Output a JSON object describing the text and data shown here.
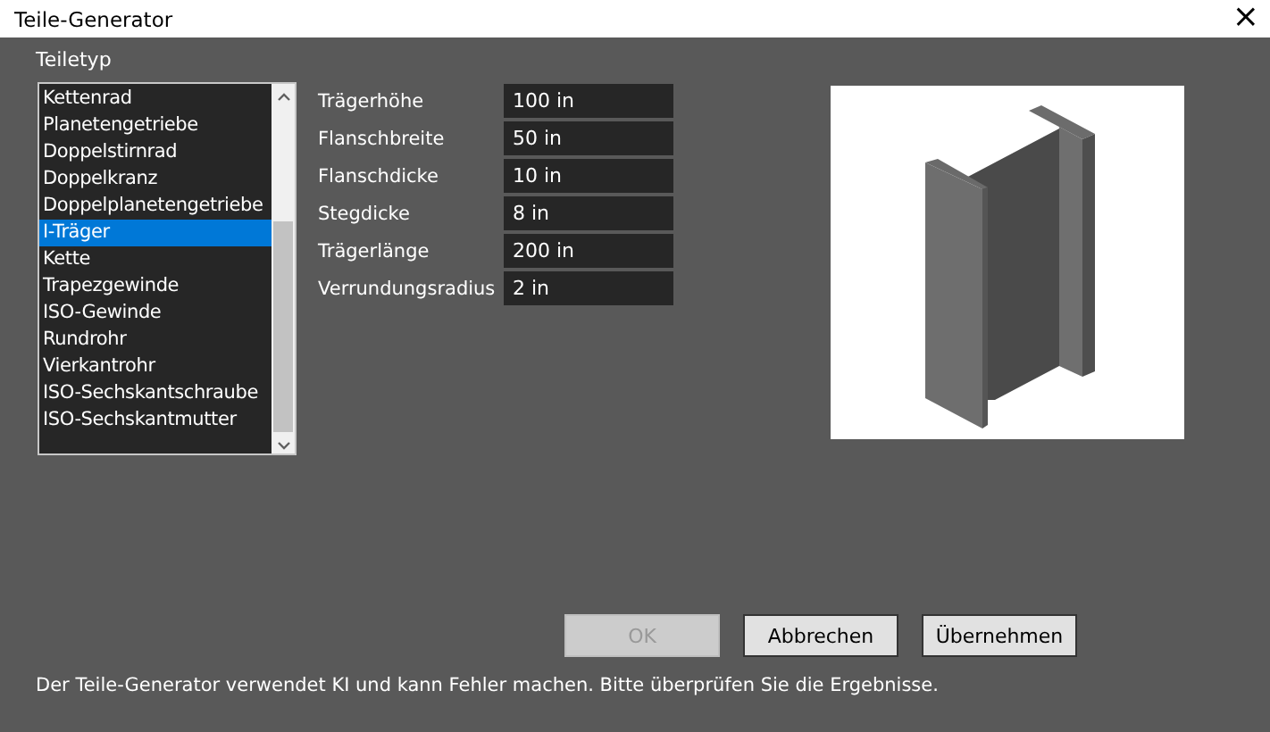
{
  "window": {
    "title": "Teile-Generator",
    "close": "×"
  },
  "part_type": {
    "label": "Teiletyp",
    "items": [
      {
        "label": "Kettenrad",
        "selected": false
      },
      {
        "label": "Planetengetriebe",
        "selected": false
      },
      {
        "label": "Doppelstirnrad",
        "selected": false
      },
      {
        "label": "Doppelkranz",
        "selected": false
      },
      {
        "label": "Doppelplanetengetriebe",
        "selected": false
      },
      {
        "label": "I-Träger",
        "selected": true
      },
      {
        "label": "Kette",
        "selected": false
      },
      {
        "label": "Trapezgewinde",
        "selected": false
      },
      {
        "label": "ISO-Gewinde",
        "selected": false
      },
      {
        "label": "Rundrohr",
        "selected": false
      },
      {
        "label": "Vierkantrohr",
        "selected": false
      },
      {
        "label": "ISO-Sechskantschraube",
        "selected": false
      },
      {
        "label": "ISO-Sechskantmutter",
        "selected": false
      }
    ]
  },
  "parameters": [
    {
      "label": "Trägerhöhe",
      "value": "100 in"
    },
    {
      "label": "Flanschbreite",
      "value": "50 in"
    },
    {
      "label": "Flanschdicke",
      "value": "10 in"
    },
    {
      "label": "Stegdicke",
      "value": "8 in"
    },
    {
      "label": "Trägerlänge",
      "value": "200 in"
    },
    {
      "label": "Verrundungsradius",
      "value": "2 in"
    }
  ],
  "buttons": [
    {
      "label": "OK",
      "disabled": true
    },
    {
      "label": "Abbrechen",
      "disabled": false
    },
    {
      "label": "Übernehmen",
      "disabled": false
    }
  ],
  "footer": "Der Teile-Generator verwendet KI und kann Fehler machen. Bitte überprüfen Sie die Ergebnisse."
}
